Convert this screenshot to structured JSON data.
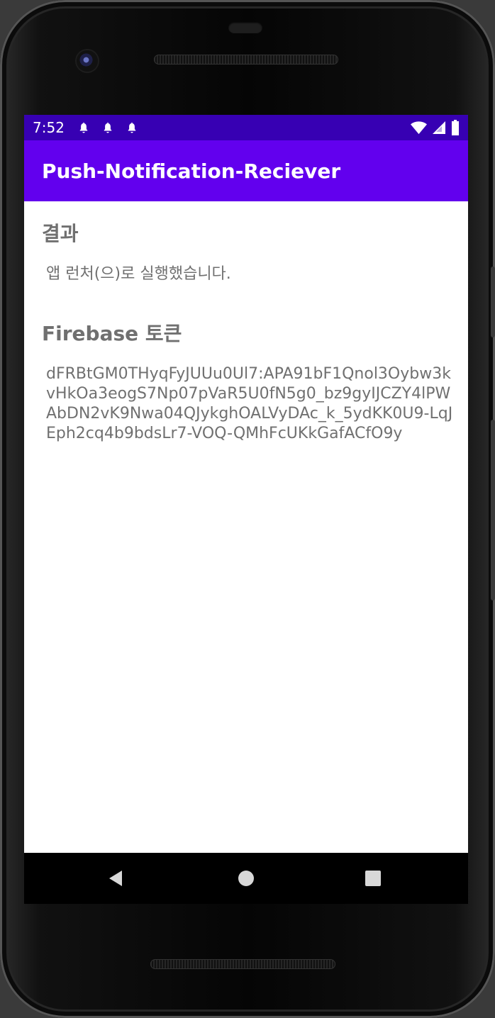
{
  "status_bar": {
    "time": "7:52",
    "left_icons": [
      "bell-icon",
      "bell-icon",
      "bell-icon"
    ],
    "right_icons": [
      "wifi-icon",
      "cellular-icon",
      "battery-icon"
    ],
    "background_color": "#3700b3"
  },
  "app_bar": {
    "title": "Push-Notification-Reciever",
    "background_color": "#6200ee"
  },
  "content": {
    "result_heading": "결과",
    "result_text": "앱 런처(으)로 실행했습니다.",
    "firebase_heading": "Firebase 토큰",
    "firebase_token": "dFRBtGM0THyqFyJUUu0Ul7:APA91bF1Qnol3Oybw3kvHkOa3eogS7Np07pVaR5U0fN5g0_bz9gyIJCZY4lPWAbDN2vK9Nwa04QJykghOALVyDAc_k_5ydKK0U9-LqJEph2cq4b9bdsLr7-VOQ-QMhFcUKkGafACfO9y"
  },
  "navigation": {
    "back_icon": "back-icon",
    "home_icon": "home-icon",
    "recent_apps_icon": "recent-apps-icon"
  },
  "colors": {
    "text_secondary": "#707070",
    "screen_background": "#ffffff",
    "device_frame": "#050505"
  }
}
